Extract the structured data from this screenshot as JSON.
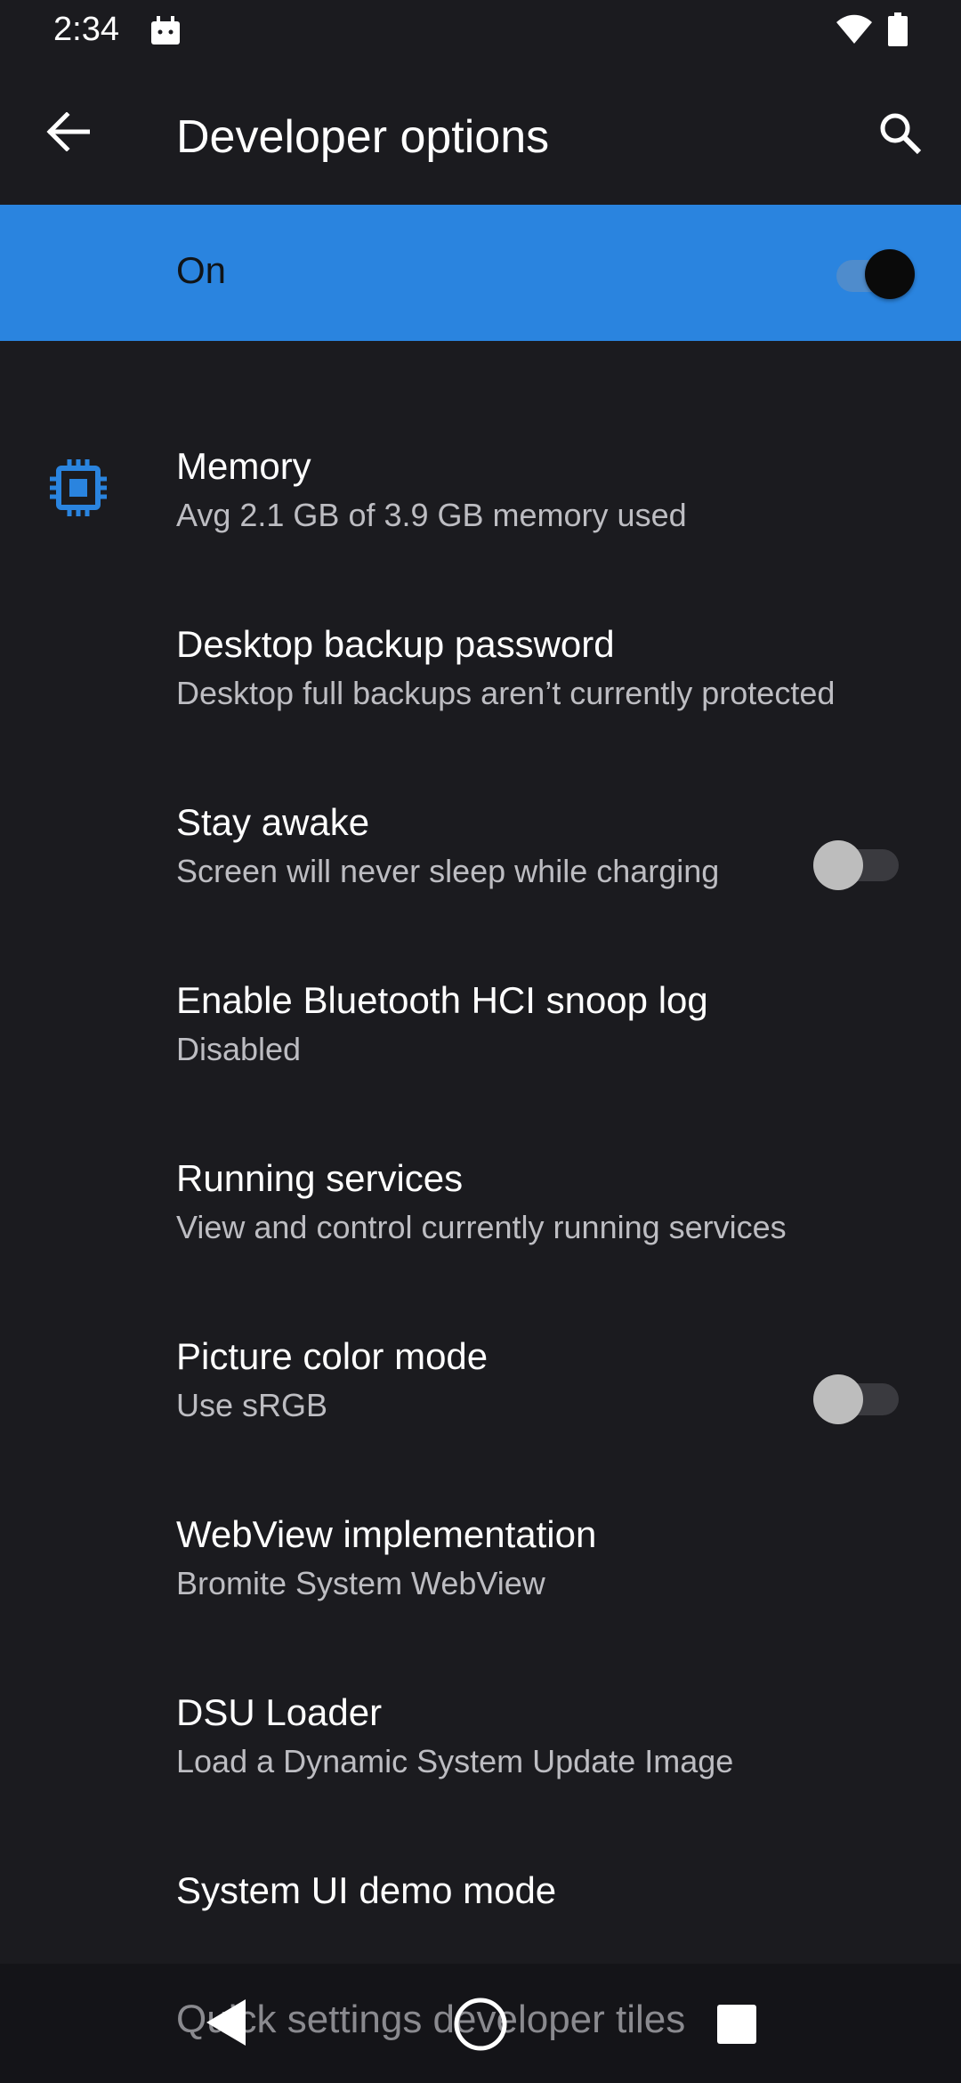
{
  "status_bar": {
    "time": "2:34",
    "icons": [
      "app-notification-icon",
      "wifi-icon",
      "battery-icon"
    ]
  },
  "app_bar": {
    "title": "Developer options",
    "back_icon": "arrow-back-icon",
    "search_icon": "search-icon"
  },
  "master_switch": {
    "label": "On",
    "checked": true
  },
  "colors": {
    "accent": "#2a84df",
    "background": "#1b1b1f",
    "summary_text": "#bdbdc2"
  },
  "settings": [
    {
      "title": "Memory",
      "summary": "Avg 2.1 GB of 3.9 GB memory used",
      "icon": "memory-chip-icon"
    },
    {
      "title": "Desktop backup password",
      "summary": "Desktop full backups aren’t currently protected"
    },
    {
      "title": "Stay awake",
      "summary": "Screen will never sleep while charging",
      "toggle": false
    },
    {
      "title": "Enable Bluetooth HCI snoop log",
      "summary": "Disabled"
    },
    {
      "title": "Running services",
      "summary": "View and control currently running services"
    },
    {
      "title": "Picture color mode",
      "summary": "Use sRGB",
      "toggle": false
    },
    {
      "title": "WebView implementation",
      "summary": "Bromite System WebView"
    },
    {
      "title": "DSU Loader",
      "summary": "Load a Dynamic System Update Image"
    },
    {
      "title": "System UI demo mode"
    }
  ],
  "nav_bar": {
    "peek_label": "Quick settings developer tiles",
    "buttons": [
      "back-triangle-icon",
      "home-circle-icon",
      "recents-square-icon"
    ]
  }
}
